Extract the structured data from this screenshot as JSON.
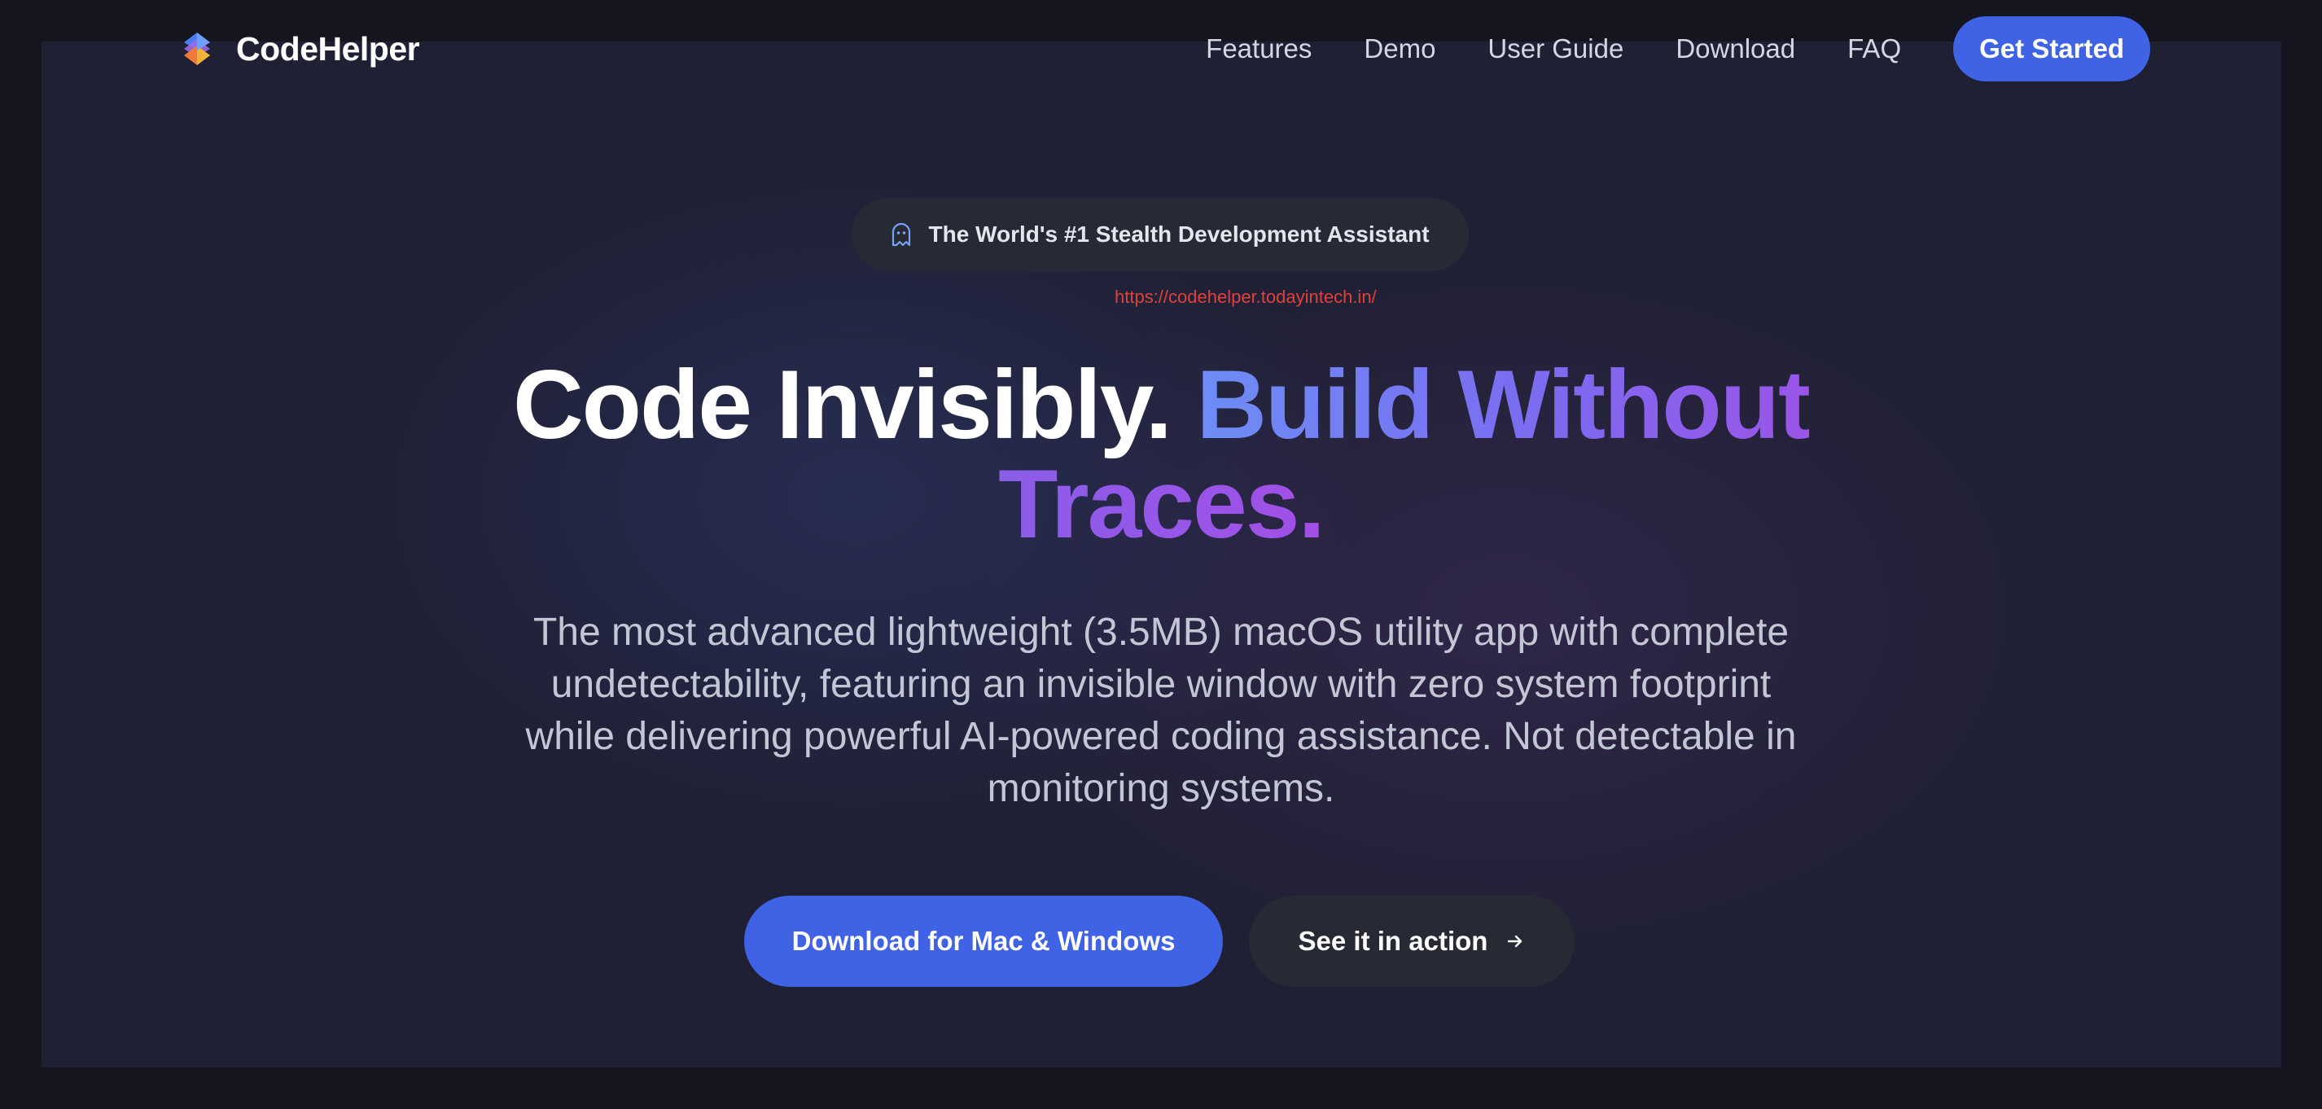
{
  "brand": {
    "name": "CodeHelper",
    "logo_icon": "layered-diamond-logo-icon"
  },
  "nav": {
    "links": [
      "Features",
      "Demo",
      "User Guide",
      "Download",
      "FAQ"
    ],
    "cta_label": "Get Started"
  },
  "hero": {
    "badge_icon": "ghost-icon",
    "badge_text": "The World's #1 Stealth Development Assistant",
    "url_note": "https://codehelper.todayintech.in/",
    "headline_white": "Code Invisibly.",
    "headline_gradient": "Build Without",
    "headline_purple": "Traces.",
    "subtitle": "The most advanced lightweight (3.5MB) macOS utility app with complete undetectability, featuring an invisible window with zero system footprint while delivering powerful AI-powered coding assistance. Not detectable in monitoring systems.",
    "primary_cta": "Download for Mac & Windows",
    "secondary_cta": "See it in action",
    "secondary_cta_icon": "arrow-right-icon"
  },
  "colors": {
    "accent": "#4063e6",
    "page_bg": "#1f2034",
    "outer_bg": "#14151f",
    "gradient_start": "#6d8df5",
    "gradient_end": "#9a55e8",
    "url_note": "#e0403c"
  }
}
